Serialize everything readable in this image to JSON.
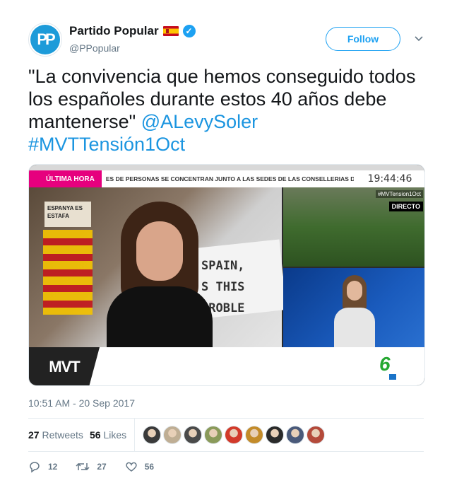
{
  "account": {
    "avatar_text": "PP",
    "display_name": "Partido Popular",
    "handle": "@PPopular",
    "follow_label": "Follow"
  },
  "tweet": {
    "text_quote": "\"La convivencia que hemos conseguido todos los españoles durante estos 40 años debe mantenerse\"",
    "mention": "@ALevySoler",
    "hashtag": "#MVTTensión1Oct"
  },
  "media": {
    "ticker_label": "ÚLTIMA HORA",
    "ticker_text": "ES DE PERSONAS SE CONCENTRAN JUNTO A LAS SEDES DE LAS CONSELLERIAS D",
    "clock": "19:44:46",
    "side_hashtag": "#MVTension1Oct",
    "live_label": "DIRECTO",
    "sign_text": "ESPANYA ES ESTAFA",
    "banner_line1": "SPAIN,",
    "banner_line2": "S THIS",
    "banner_line3": "PROBLE",
    "show_logo": "MVT",
    "channel_logo": "6"
  },
  "timestamp": "10:51 AM - 20 Sep 2017",
  "stats": {
    "retweets_count": "27",
    "retweets_label": "Retweets",
    "likes_count": "56",
    "likes_label": "Likes"
  },
  "likers_colors": [
    "#3a3a3a",
    "#bfae94",
    "#4a4a4a",
    "#8a9a5a",
    "#d23a2a",
    "#c38b2a",
    "#2a2a2a",
    "#4a5a7a",
    "#b44a3a"
  ],
  "actions": {
    "reply_count": "12",
    "retweet_count": "27",
    "like_count": "56"
  },
  "colors": {
    "accent": "#1da1f2",
    "link": "#1b95e0",
    "secondary_text": "#657786"
  }
}
